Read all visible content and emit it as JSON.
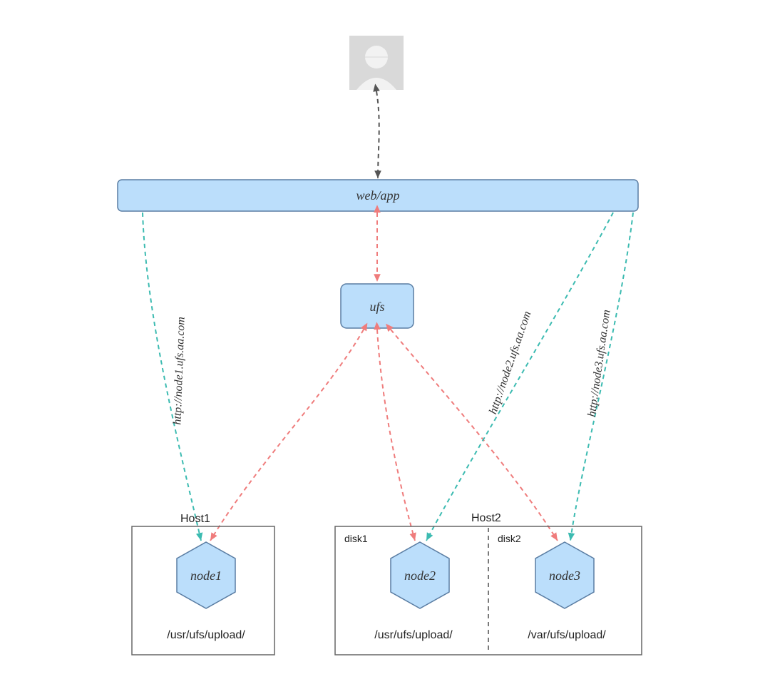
{
  "user_icon": "user-icon",
  "webapp": {
    "label": "web/app"
  },
  "ufs": {
    "label": "ufs"
  },
  "hosts": {
    "host1": {
      "title": "Host1",
      "nodes": [
        {
          "name": "node1",
          "path": "/usr/ufs/upload/",
          "url": "http://node1.ufs.aa.com"
        }
      ]
    },
    "host2": {
      "title": "Host2",
      "disks": [
        {
          "disk_label": "disk1",
          "node_name": "node2",
          "path": "/usr/ufs/upload/",
          "url": "http://node2.ufs.aa.com"
        },
        {
          "disk_label": "disk2",
          "node_name": "node3",
          "path": "/var/ufs/upload/",
          "url": "http://node3.ufs.aa.com"
        }
      ]
    }
  },
  "colors": {
    "node_fill": "#bbdefb",
    "node_stroke": "#5a7da3",
    "box_stroke": "#666666",
    "arrow_gray": "#555555",
    "arrow_red": "#ef7c7c",
    "arrow_teal": "#3cbbb1"
  }
}
